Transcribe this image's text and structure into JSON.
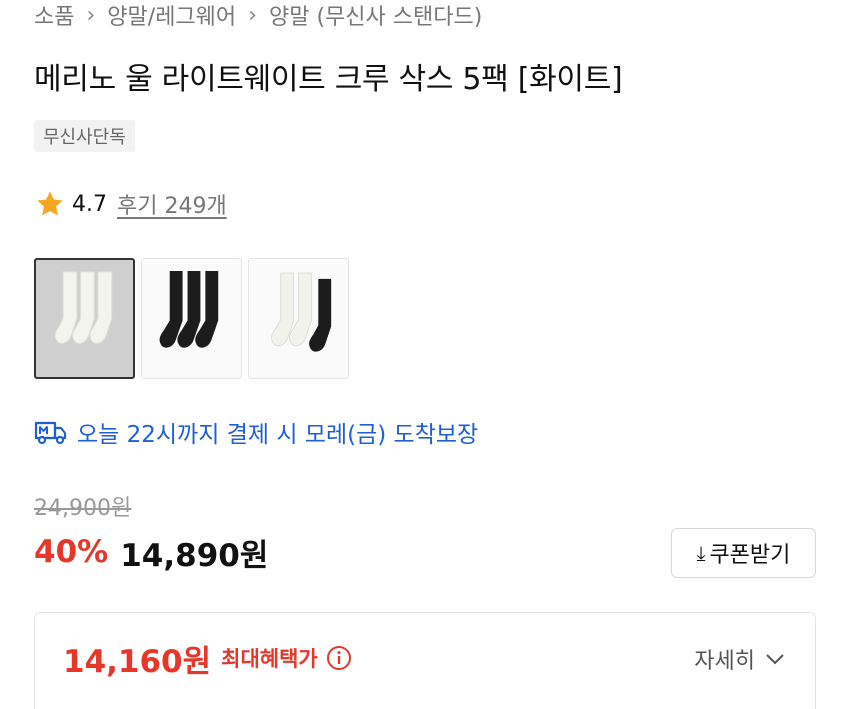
{
  "breadcrumb": [
    "소품",
    "양말/레그웨어",
    "양말 (무신사 스탠다드)"
  ],
  "product": {
    "title": "메리노 울 라이트웨이트 크루 삭스 5팩 [화이트]",
    "badge": "무신사단독",
    "rating": "4.7",
    "reviews": "후기 249개"
  },
  "thumbnails": [
    {
      "name": "white-socks",
      "selected": true
    },
    {
      "name": "black-socks",
      "selected": false
    },
    {
      "name": "mixed-socks",
      "selected": false
    }
  ],
  "delivery": {
    "text": "오늘 22시까지 결제 시 모레(금) 도착보장",
    "icon": "truck-icon",
    "color": "#1f5fd6"
  },
  "pricing": {
    "original": "24,900원",
    "discount": "40%",
    "price": "14,890원",
    "coupon_label": "쿠폰받기",
    "accent": "#e5372a"
  },
  "benefit": {
    "price": "14,160원",
    "label": "최대혜택가",
    "detail": "자세히"
  }
}
